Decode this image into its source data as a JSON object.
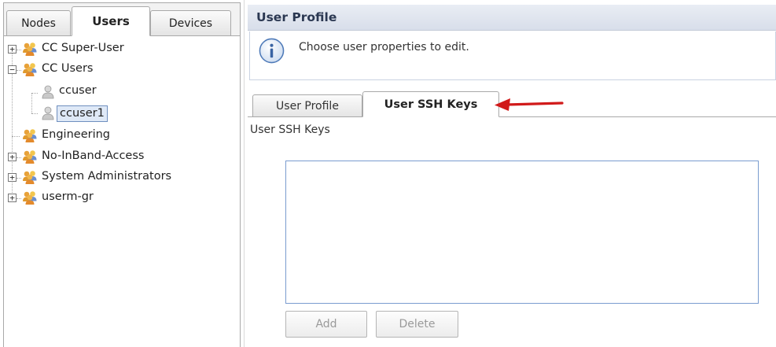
{
  "left_tabs": [
    "Nodes",
    "Users",
    "Devices"
  ],
  "active_left_tab": "Users",
  "tree": {
    "items": [
      {
        "label": "CC Super-User",
        "expander": "+",
        "icon": "user-group-icon"
      },
      {
        "label": "CC Users",
        "expander": "−",
        "icon": "user-group-icon"
      },
      {
        "label": "ccuser",
        "icon": "user-icon"
      },
      {
        "label": "ccuser1",
        "icon": "user-icon",
        "selected": true
      },
      {
        "label": "Engineering",
        "icon": "user-group-icon"
      },
      {
        "label": "No-InBand-Access",
        "expander": "+",
        "icon": "user-group-icon"
      },
      {
        "label": "System Administrators",
        "expander": "+",
        "icon": "user-group-icon"
      },
      {
        "label": "userm-gr",
        "expander": "+",
        "icon": "user-group-icon"
      }
    ]
  },
  "right_panel": {
    "title": "User Profile",
    "info_text": "Choose user properties to edit.",
    "tabs": [
      "User Profile",
      "User SSH Keys"
    ],
    "active_tab": "User SSH Keys",
    "section_label": "User SSH Keys",
    "buttons": {
      "add": "Add",
      "delete": "Delete"
    }
  },
  "colors": {
    "selection": "#dfe9f7",
    "list_border": "#7a9ccf",
    "arrow": "#d11a1a",
    "info_icon": "#4d79b8"
  }
}
